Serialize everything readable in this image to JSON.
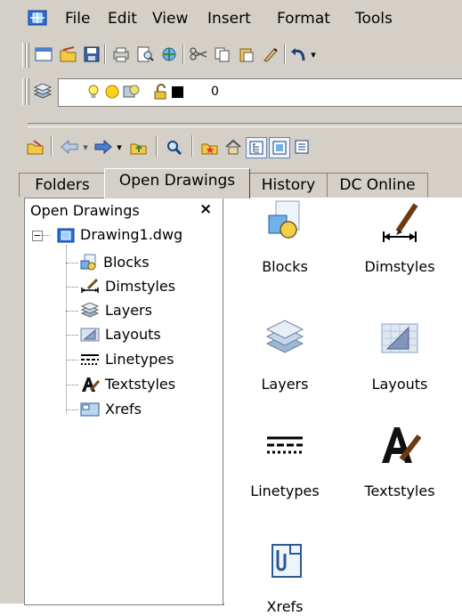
{
  "menubar": {
    "items": [
      {
        "label": "File"
      },
      {
        "label": "Edit"
      },
      {
        "label": "View"
      },
      {
        "label": "Insert"
      },
      {
        "label": "Format"
      },
      {
        "label": "Tools"
      }
    ]
  },
  "layer_toolbar": {
    "current_layer": "0"
  },
  "tabs": [
    {
      "label": "Folders",
      "active": false
    },
    {
      "label": "Open Drawings",
      "active": true
    },
    {
      "label": "History",
      "active": false
    },
    {
      "label": "DC Online",
      "active": false
    }
  ],
  "tree": {
    "header": "Open Drawings",
    "close_glyph": "×",
    "root": {
      "label": "Drawing1.dwg",
      "expander": "−"
    },
    "children": [
      {
        "label": "Blocks",
        "icon": "blocks-icon"
      },
      {
        "label": "Dimstyles",
        "icon": "dimstyles-icon"
      },
      {
        "label": "Layers",
        "icon": "layers-icon"
      },
      {
        "label": "Layouts",
        "icon": "layouts-icon"
      },
      {
        "label": "Linetypes",
        "icon": "linetypes-icon"
      },
      {
        "label": "Textstyles",
        "icon": "textstyles-icon"
      },
      {
        "label": "Xrefs",
        "icon": "xrefs-icon"
      }
    ]
  },
  "content": {
    "items": [
      {
        "label": "Blocks",
        "icon": "blocks-icon"
      },
      {
        "label": "Dimstyles",
        "icon": "dimstyles-icon"
      },
      {
        "label": "Layers",
        "icon": "layers-icon"
      },
      {
        "label": "Layouts",
        "icon": "layouts-icon"
      },
      {
        "label": "Linetypes",
        "icon": "linetypes-icon"
      },
      {
        "label": "Textstyles",
        "icon": "textstyles-icon"
      },
      {
        "label": "Xrefs",
        "icon": "xrefs-icon"
      }
    ]
  }
}
